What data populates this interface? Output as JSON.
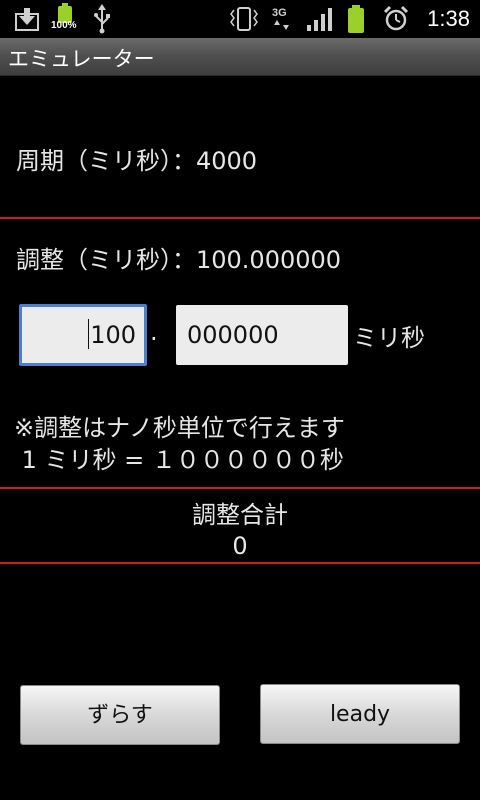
{
  "status_bar": {
    "battery_percent_label": "100%",
    "clock": "1:38",
    "network_label": "3G"
  },
  "title_bar": {
    "title": "エミュレーター"
  },
  "main": {
    "period_text": "周期（ミリ秒）：4000",
    "adjust_text": "調整（ミリ秒）：100.000000",
    "adjust_int_value": "100",
    "separator": ".",
    "adjust_frac_value": "000000",
    "unit_label": "ミリ秒",
    "note_line1": "※調整はナノ秒単位で行えます",
    "note_line2": " 1 ミリ秒 = １００００００秒",
    "total_label": "調整合計",
    "total_value": "0"
  },
  "buttons": {
    "shift_label": "ずらす",
    "ready_label": "leady"
  },
  "colors": {
    "background": "#000000",
    "divider": "#c62020",
    "focus_border": "#4b7fcf"
  }
}
